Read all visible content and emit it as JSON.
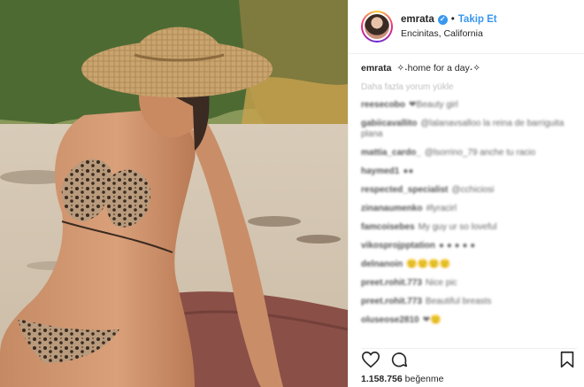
{
  "colors": {
    "accent": "#3897f0",
    "text": "#262626",
    "muted": "#c0c0c0",
    "border": "#efefef"
  },
  "header": {
    "username": "emrata",
    "verified_icon": "verified-badge-icon",
    "separator": "•",
    "follow_label": "Takip Et",
    "location": "Encinitas, California"
  },
  "caption": {
    "username": "emrata",
    "text": "✧˖home for a day˖✧"
  },
  "load_more": "Daha fazla yorum yükle",
  "comments": [
    {
      "user": "reesecobo",
      "text": "❤Beauty girl"
    },
    {
      "user": "gabiicavallito",
      "text": "@lalanavsalloo la reina de barriguita plana"
    },
    {
      "user": "mattia_cardo_",
      "text": "@lsorrino_79 anche tu racio"
    },
    {
      "user": "haymed1",
      "text": "●●"
    },
    {
      "user": "respected_specialist",
      "text": "@cchiciosi"
    },
    {
      "user": "zinanaumenko",
      "text": "#lyracirl"
    },
    {
      "user": "famcoisebes",
      "text": "My guy ur so loveful"
    },
    {
      "user": "vikosprojpptation",
      "text": "● ● ● ● ●"
    },
    {
      "user": "delnanoin",
      "text": "🙂🙂🙂🙂"
    },
    {
      "user": "preet.rohit.773",
      "text": "Nice pic"
    },
    {
      "user": "preet.rohit.773",
      "text": "Beautiful breasts"
    },
    {
      "user": "oluseose2810",
      "text": "❤🙂"
    }
  ],
  "actions": {
    "like_icon": "heart-icon",
    "comment_icon": "comment-icon",
    "save_icon": "bookmark-icon"
  },
  "likes": {
    "count": "1.158.756",
    "label": "beğenme"
  }
}
